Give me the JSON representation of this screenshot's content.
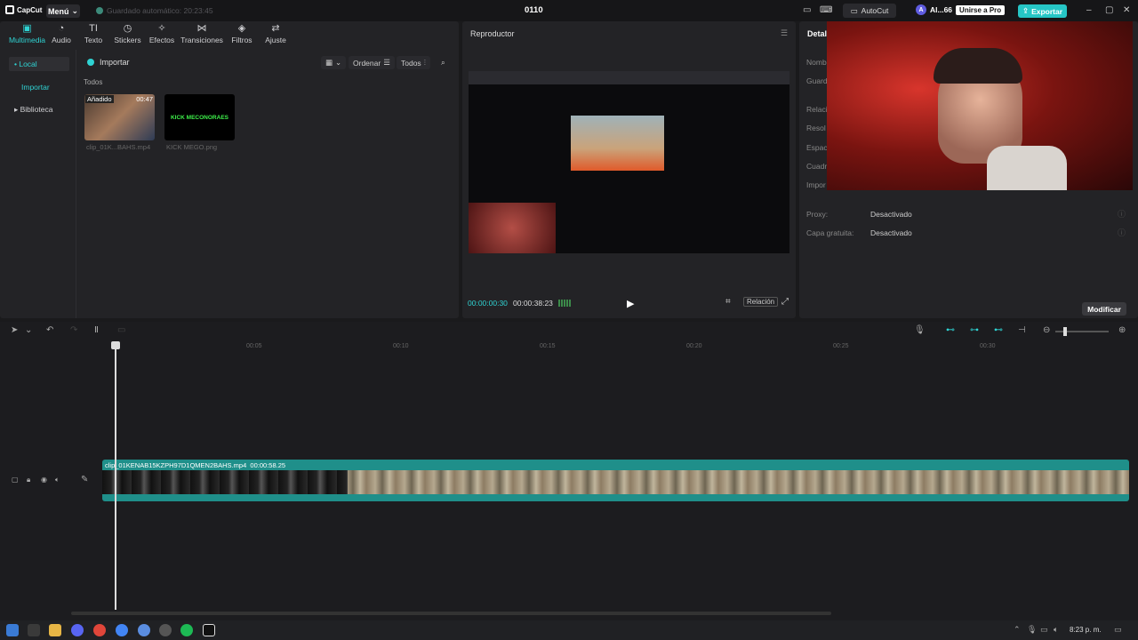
{
  "app": {
    "logo_text": "CapCut",
    "menu_label": "Menú",
    "autosave_text": "Guardado automático: 20:23:45",
    "project_title": "0110",
    "autocut_label": "AutoCut",
    "user_name": "Al...66",
    "pro_label": "Unirse a Pro",
    "export_label": "Exportar"
  },
  "media": {
    "tabs": [
      {
        "label": "Multimedia",
        "icon": "▣"
      },
      {
        "label": "Audio",
        "icon": "◔"
      },
      {
        "label": "Texto",
        "icon": "TI"
      },
      {
        "label": "Stickers",
        "icon": "◷"
      },
      {
        "label": "Efectos",
        "icon": "✧"
      },
      {
        "label": "Transiciones",
        "icon": "⋈"
      },
      {
        "label": "Filtros",
        "icon": "◈"
      },
      {
        "label": "Ajuste",
        "icon": "⇄"
      }
    ],
    "side": {
      "local": "• Local",
      "import": "Importar",
      "library": "▸ Biblioteca"
    },
    "import_label": "Importar",
    "sort_label": "Ordenar",
    "filter_label": "Todos",
    "all_label": "Todos",
    "thumbs": [
      {
        "badge": "Añadido",
        "duration": "00:47",
        "name": "clip_01K...BAHS.mp4"
      },
      {
        "text": "KICK MECONORAES",
        "name": "KICK MEGO.png"
      }
    ]
  },
  "player": {
    "title": "Reproductor",
    "time_current": "00:00:00:30",
    "time_total": "00:00:38:23",
    "ratio_label": "Relación"
  },
  "details": {
    "title": "Detal",
    "rows": [
      {
        "label": "Nomb",
        "value": ""
      },
      {
        "label": "Guard",
        "value": ""
      },
      {
        "label": "Relaci",
        "value": ""
      },
      {
        "label": "Resol",
        "value": ""
      },
      {
        "label": "Espac",
        "value": ""
      },
      {
        "label": "Cuadr",
        "value": ""
      },
      {
        "label": "Impor",
        "value": ""
      },
      {
        "label": "Proxy:",
        "value": "Desactivado"
      },
      {
        "label": "Capa gratuita:",
        "value": "Desactivado"
      }
    ],
    "modify_label": "Modificar"
  },
  "timeline": {
    "ticks": [
      "00:05",
      "00:10",
      "00:15",
      "00:20",
      "00:25",
      "00:30"
    ],
    "clip_label": "clip_01KENAB15KZPH97D1QMEN2BAHS.mp4",
    "clip_duration": "00:00:58.25"
  },
  "taskbar": {
    "clock": "8:23 p. m."
  },
  "colors": {
    "accent": "#2fd3d3",
    "clip": "#1f8f8a"
  }
}
